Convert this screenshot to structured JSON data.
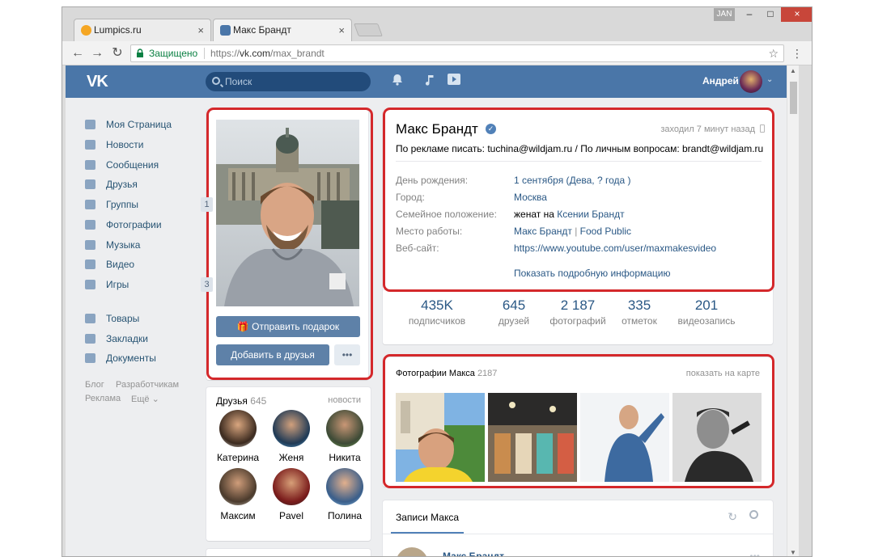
{
  "browser": {
    "tabs": [
      {
        "title": "Lumpics.ru",
        "close": "×"
      },
      {
        "title": "Макс Брандт",
        "close": "×"
      }
    ],
    "user_badge": "JAN",
    "controls": {
      "minimize": "–",
      "maximize": "□",
      "close": "×"
    },
    "nav": {
      "back": "←",
      "forward": "→",
      "reload": "↻"
    },
    "secure_label": "Защищено",
    "url_scheme": "https://",
    "url_host": "vk.com",
    "url_path": "/max_brandt",
    "star": "☆",
    "menu": "⋮"
  },
  "vk": {
    "logo": "VK",
    "search_placeholder": "Поиск",
    "user_name": "Андрей",
    "menu": [
      {
        "label": "Моя Страница",
        "icon": "home-icon"
      },
      {
        "label": "Новости",
        "icon": "news-icon"
      },
      {
        "label": "Сообщения",
        "icon": "messages-icon"
      },
      {
        "label": "Друзья",
        "icon": "friends-icon"
      },
      {
        "label": "Группы",
        "icon": "groups-icon",
        "badge": "1"
      },
      {
        "label": "Фотографии",
        "icon": "camera-icon"
      },
      {
        "label": "Музыка",
        "icon": "music-icon"
      },
      {
        "label": "Видео",
        "icon": "video-icon"
      },
      {
        "label": "Игры",
        "icon": "games-icon",
        "badge": "3"
      },
      {
        "label": "Товары",
        "icon": "shop-icon"
      },
      {
        "label": "Закладки",
        "icon": "star-icon"
      },
      {
        "label": "Документы",
        "icon": "document-icon"
      }
    ],
    "footer_links": [
      "Блог",
      "Разработчикам",
      "Реклама",
      "Ещё"
    ]
  },
  "profile": {
    "gift_button": "Отправить подарок",
    "add_friend_button": "Добавить в друзья",
    "more_button": "•••",
    "name": "Макс Брандт",
    "last_seen": "заходил 7 минут назад",
    "status": "По рекламе писать: tuchina@wildjam.ru / По личным вопросам: brandt@wildjam.ru",
    "info": {
      "birthday_label": "День рождения:",
      "birthday_value": "1 сентября",
      "birthday_extra_open": " (",
      "birthday_sign": "Дева",
      "birthday_sep": ", ",
      "birthday_year": "? года",
      "birthday_extra_close": " )",
      "city_label": "Город:",
      "city_value": "Москва",
      "family_label": "Семейное положение:",
      "family_prefix": "женат на ",
      "family_value": "Ксении Брандт",
      "work_label": "Место работы:",
      "work_value": "Макс Брандт",
      "work_sep": " | ",
      "work_value2": "Food Public",
      "site_label": "Веб-сайт:",
      "site_value": "https://www.youtube.com/user/maxmakesvideo",
      "more_info": "Показать подробную информацию"
    },
    "stats": [
      {
        "value": "435K",
        "label": "подписчиков"
      },
      {
        "value": "645",
        "label": "друзей"
      },
      {
        "value": "2 187",
        "label": "фотографий"
      },
      {
        "value": "335",
        "label": "отметок"
      },
      {
        "value": "201",
        "label": "видеозапись"
      }
    ],
    "photos_title": "Фотографии Макса",
    "photos_count": "2187",
    "photos_map_link": "показать на карте",
    "friends_title": "Друзья",
    "friends_count": "645",
    "friends_news": "новости",
    "friends": [
      "Катерина",
      "Женя",
      "Никита",
      "Максим",
      "Pavel",
      "Полина"
    ],
    "posts_title": "Записи Макса",
    "post_author": "Макс Брандт"
  }
}
